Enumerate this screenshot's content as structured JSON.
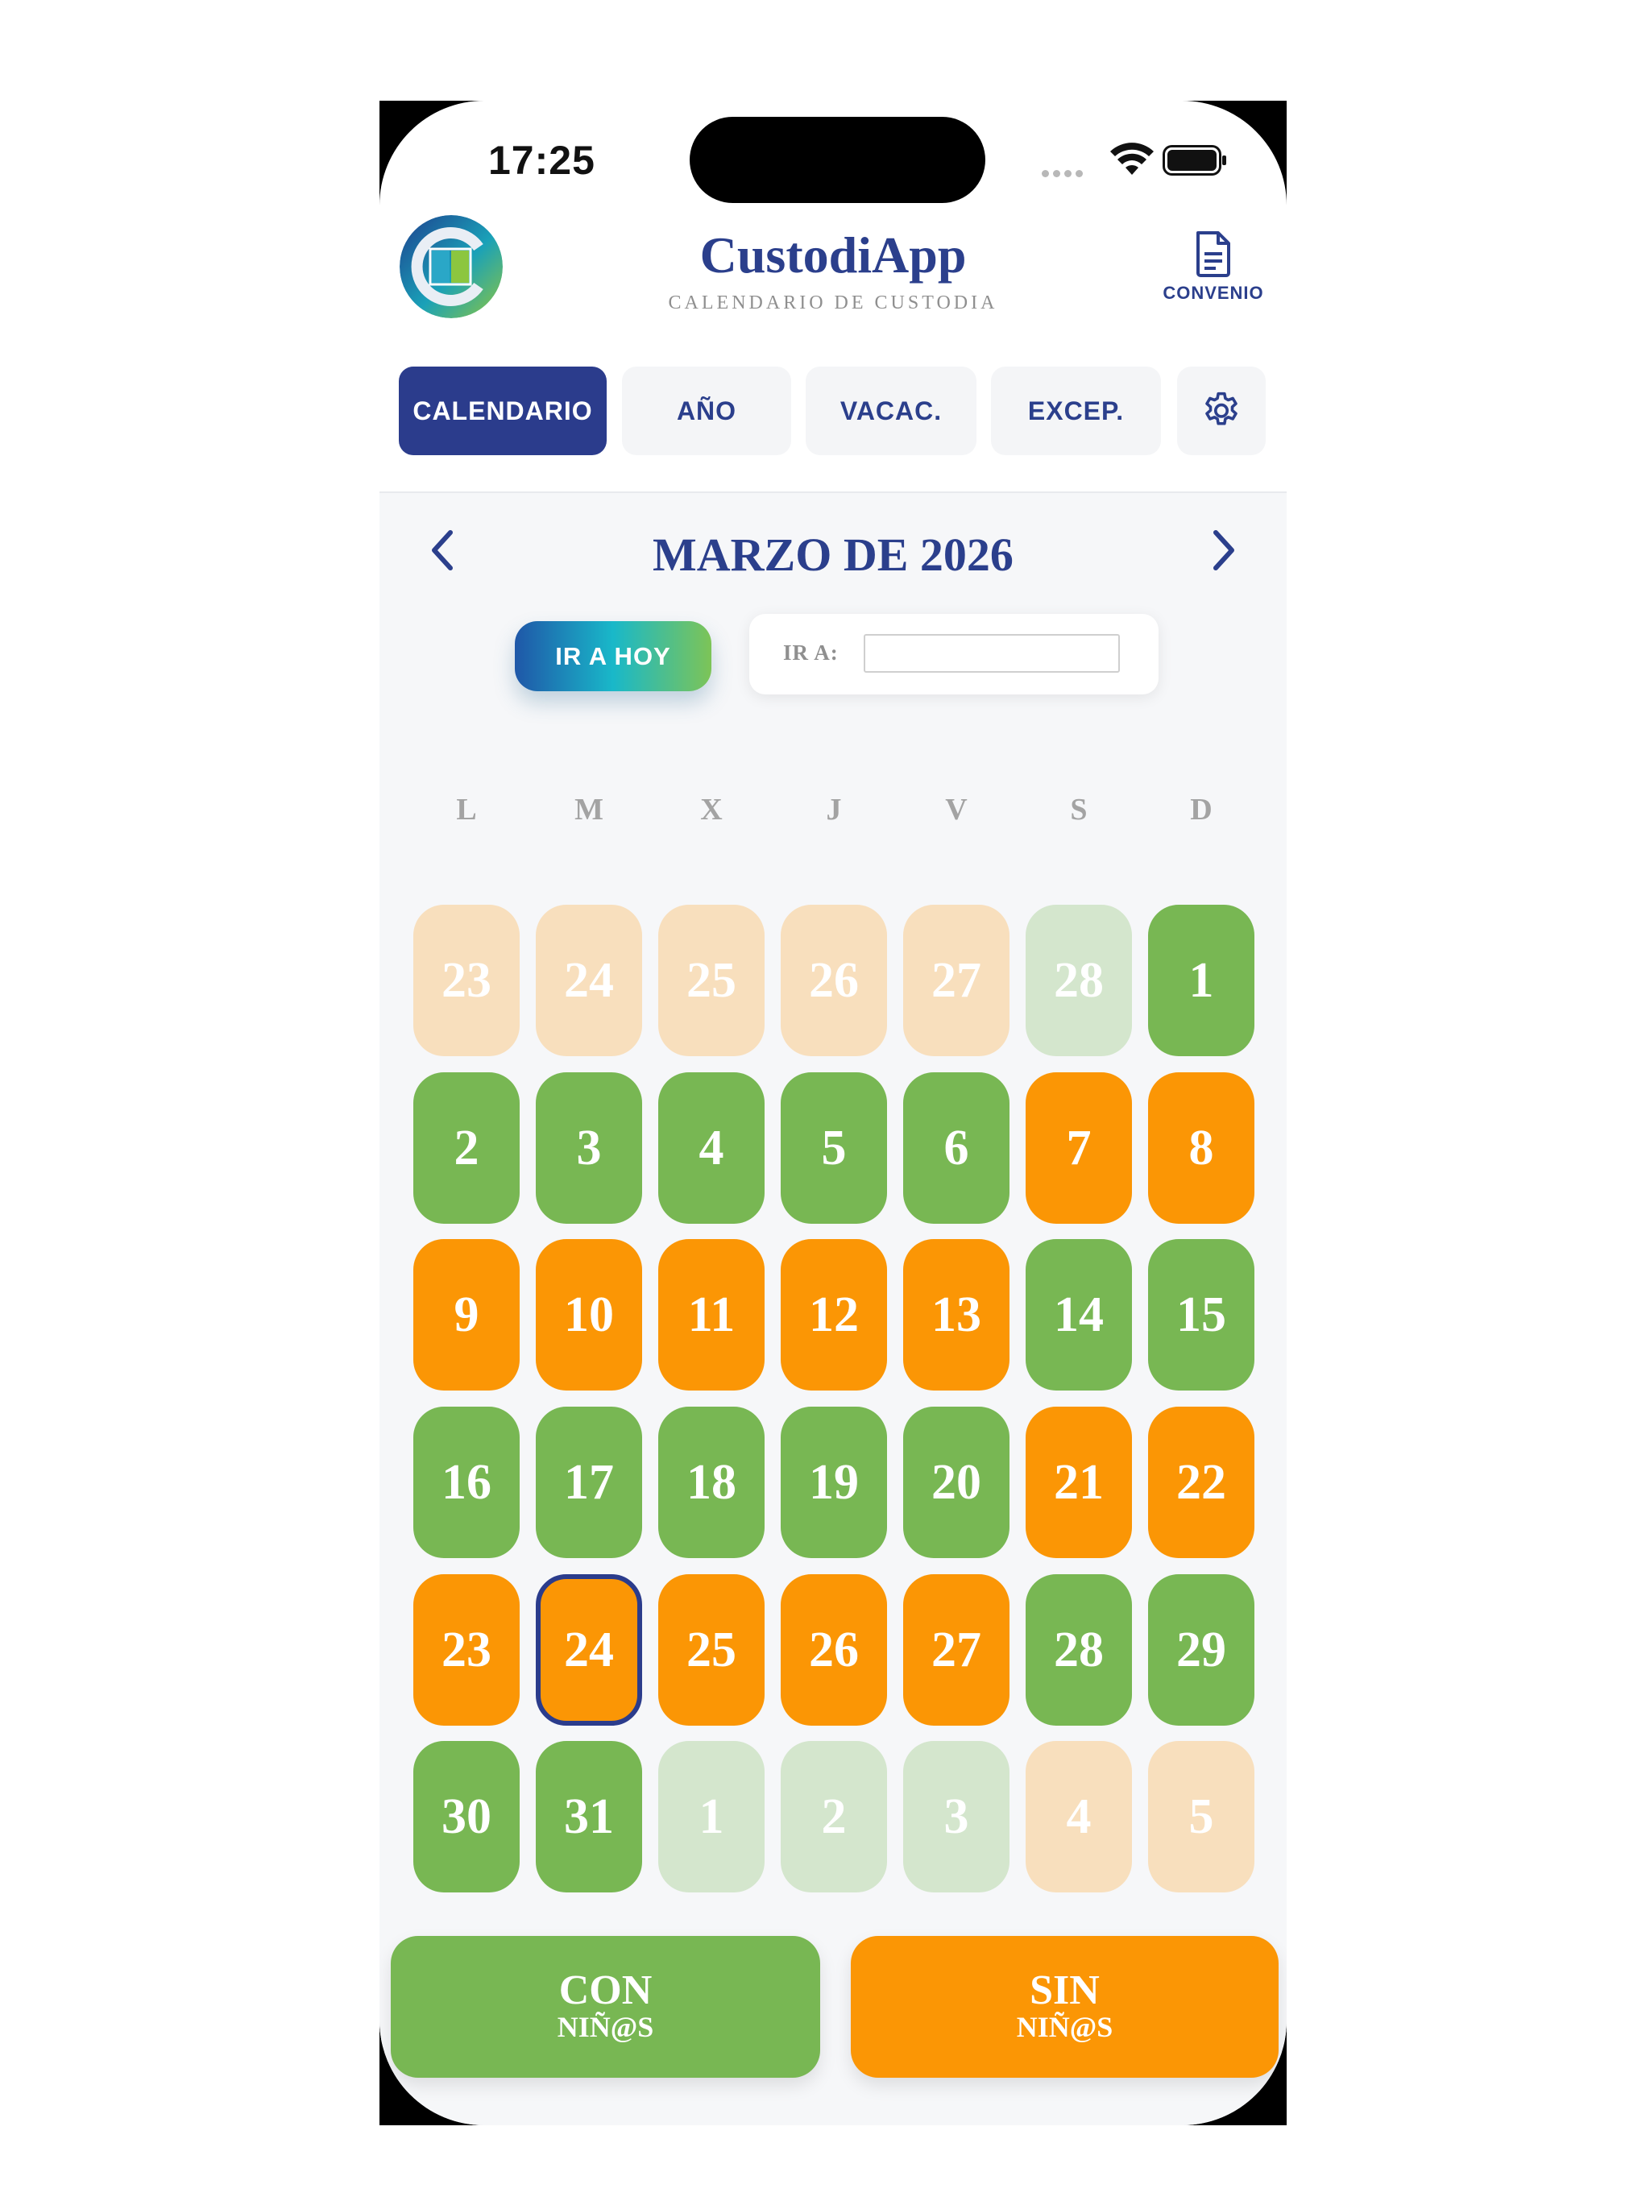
{
  "status_bar": {
    "time": "17:25"
  },
  "header": {
    "title": "CustodiApp",
    "subtitle": "CALENDARIO DE CUSTODIA",
    "convenio_label": "CONVENIO"
  },
  "tabs": [
    {
      "label": "CALENDARIO",
      "active": true
    },
    {
      "label": "AÑO"
    },
    {
      "label": "VACAC."
    },
    {
      "label": "EXCEP."
    }
  ],
  "calendar": {
    "month_title": "MARZO DE 2026",
    "today_button": "IR A HOY",
    "goto_label": "IR A:",
    "goto_value": "",
    "weekdays": [
      "L",
      "M",
      "X",
      "J",
      "V",
      "S",
      "D"
    ],
    "weeks": [
      [
        {
          "n": "23",
          "s": "pale-orange"
        },
        {
          "n": "24",
          "s": "pale-orange"
        },
        {
          "n": "25",
          "s": "pale-orange"
        },
        {
          "n": "26",
          "s": "pale-orange"
        },
        {
          "n": "27",
          "s": "pale-orange"
        },
        {
          "n": "28",
          "s": "pale-green"
        },
        {
          "n": "1",
          "s": "green"
        }
      ],
      [
        {
          "n": "2",
          "s": "green"
        },
        {
          "n": "3",
          "s": "green"
        },
        {
          "n": "4",
          "s": "green"
        },
        {
          "n": "5",
          "s": "green"
        },
        {
          "n": "6",
          "s": "green"
        },
        {
          "n": "7",
          "s": "orange"
        },
        {
          "n": "8",
          "s": "orange"
        }
      ],
      [
        {
          "n": "9",
          "s": "orange"
        },
        {
          "n": "10",
          "s": "orange"
        },
        {
          "n": "11",
          "s": "orange"
        },
        {
          "n": "12",
          "s": "orange"
        },
        {
          "n": "13",
          "s": "orange"
        },
        {
          "n": "14",
          "s": "green"
        },
        {
          "n": "15",
          "s": "green"
        }
      ],
      [
        {
          "n": "16",
          "s": "green"
        },
        {
          "n": "17",
          "s": "green"
        },
        {
          "n": "18",
          "s": "green"
        },
        {
          "n": "19",
          "s": "green"
        },
        {
          "n": "20",
          "s": "green"
        },
        {
          "n": "21",
          "s": "orange"
        },
        {
          "n": "22",
          "s": "orange"
        }
      ],
      [
        {
          "n": "23",
          "s": "orange"
        },
        {
          "n": "24",
          "s": "orange",
          "today": true
        },
        {
          "n": "25",
          "s": "orange"
        },
        {
          "n": "26",
          "s": "orange"
        },
        {
          "n": "27",
          "s": "orange"
        },
        {
          "n": "28",
          "s": "green"
        },
        {
          "n": "29",
          "s": "green"
        }
      ],
      [
        {
          "n": "30",
          "s": "green"
        },
        {
          "n": "31",
          "s": "green"
        },
        {
          "n": "1",
          "s": "pale-green"
        },
        {
          "n": "2",
          "s": "pale-green"
        },
        {
          "n": "3",
          "s": "pale-green"
        },
        {
          "n": "4",
          "s": "pale-orange"
        },
        {
          "n": "5",
          "s": "pale-orange"
        }
      ]
    ]
  },
  "legend": {
    "con_line1": "CON",
    "con_line2": "NIÑ@S",
    "sin_line1": "SIN",
    "sin_line2": "NIÑ@S"
  },
  "colors": {
    "brand": "#2b3c8c",
    "with_children": "#78b753",
    "without_children": "#fb9605",
    "other_month_with": "#d4e6cd",
    "other_month_without": "#f8dfbd"
  }
}
